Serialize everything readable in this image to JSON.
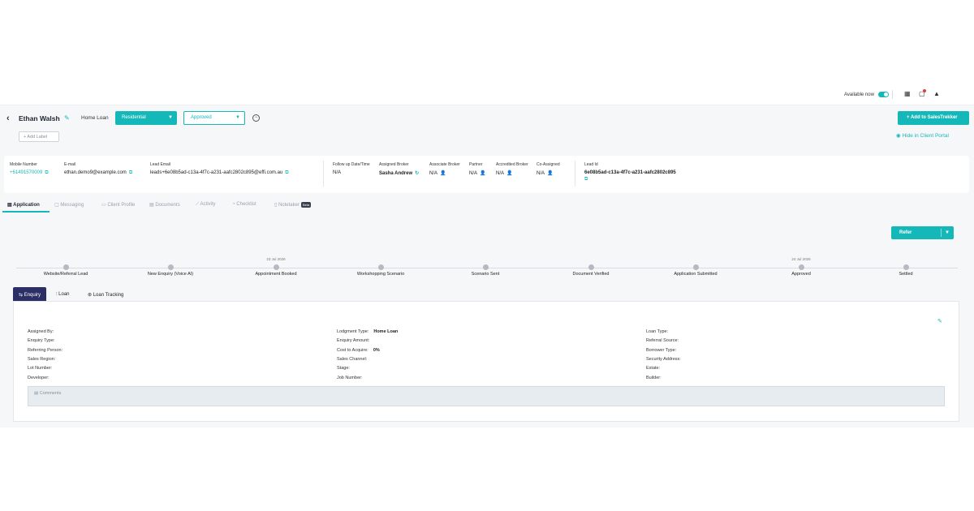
{
  "topbar": {
    "available_label": "Available now"
  },
  "header": {
    "back_glyph": "‹",
    "client_name": "Ethan Walsh",
    "loan_type": "Home Loan",
    "category_dropdown": "Residential",
    "status_dropdown": "Approved",
    "add_label": "+ Add Label",
    "add_salestrekker": "+ Add to SalesTrekker",
    "hide_portal": "Hide in Client Portal"
  },
  "info": {
    "mobile": {
      "label": "Mobile Number",
      "value": "+61491570009"
    },
    "email": {
      "label": "E-mail",
      "value": "ethan.demo9@example.com"
    },
    "lead_email": {
      "label": "Lead Email",
      "value": "leads+6e08b5ad-c13a-4f7c-a231-aafc2802c895@effi.com.au"
    },
    "follow_up": {
      "label": "Follow up Date/Time",
      "value": "N/A"
    },
    "assigned_broker": {
      "label": "Assigned Broker",
      "value": "Sasha Andrew"
    },
    "associate_broker": {
      "label": "Associate Broker",
      "value": "N/A"
    },
    "partner": {
      "label": "Partner",
      "value": "N/A"
    },
    "accredited_broker": {
      "label": "Accredited Broker",
      "value": "N/A"
    },
    "co_assigned": {
      "label": "Co-Assigned",
      "value": "N/A"
    },
    "lead_id": {
      "label": "Lead Id",
      "value": "6e08b5ad-c13a-4f7c-a231-aafc2802c895"
    }
  },
  "tabs": [
    {
      "label": "Application"
    },
    {
      "label": "Messaging"
    },
    {
      "label": "Client Profile"
    },
    {
      "label": "Documents"
    },
    {
      "label": "Activity"
    },
    {
      "label": "Checklist"
    },
    {
      "label": "Notetaker",
      "badge": "Beta"
    }
  ],
  "refer_button": "Refer",
  "steps": [
    {
      "label": "Website/Referral Lead",
      "date": ""
    },
    {
      "label": "New Enquiry (Voice AI)",
      "date": ""
    },
    {
      "label": "Appointment Booked",
      "date": "23 Jul 2026"
    },
    {
      "label": "Workshopping Scenario",
      "date": ""
    },
    {
      "label": "Scenario Sent",
      "date": ""
    },
    {
      "label": "Document Verified",
      "date": ""
    },
    {
      "label": "Application Submitted",
      "date": ""
    },
    {
      "label": "Approved",
      "date": "24 Jul 2026"
    },
    {
      "label": "Settled",
      "date": ""
    }
  ],
  "subtabs": [
    "Enquiry",
    "Loan",
    "Loan Tracking"
  ],
  "enquiry": {
    "col1": [
      {
        "label": "Assigned By:",
        "value": ""
      },
      {
        "label": "Enquiry Type:",
        "value": ""
      },
      {
        "label": "Referring Person:",
        "value": ""
      },
      {
        "label": "Sales Region:",
        "value": ""
      },
      {
        "label": "Lot Number:",
        "value": ""
      },
      {
        "label": "Developer:",
        "value": ""
      }
    ],
    "col2": [
      {
        "label": "Lodgment Type:",
        "value": "Home Loan"
      },
      {
        "label": "Enquiry Amount:",
        "value": ""
      },
      {
        "label": "Cost to Acquire:",
        "value": "0%"
      },
      {
        "label": "Sales Channel:",
        "value": ""
      },
      {
        "label": "Stage:",
        "value": ""
      },
      {
        "label": "Job Number:",
        "value": ""
      }
    ],
    "col3": [
      {
        "label": "Loan Type:",
        "value": ""
      },
      {
        "label": "Referral Source:",
        "value": ""
      },
      {
        "label": "Borrower Type:",
        "value": ""
      },
      {
        "label": "Security Address:",
        "value": ""
      },
      {
        "label": "Estate:",
        "value": ""
      },
      {
        "label": "Builder:",
        "value": ""
      }
    ],
    "comments_label": "Comments"
  },
  "colors": {
    "accent": "#14b8b8",
    "subtab_active": "#2b2f66",
    "alert": "#e2384d"
  }
}
